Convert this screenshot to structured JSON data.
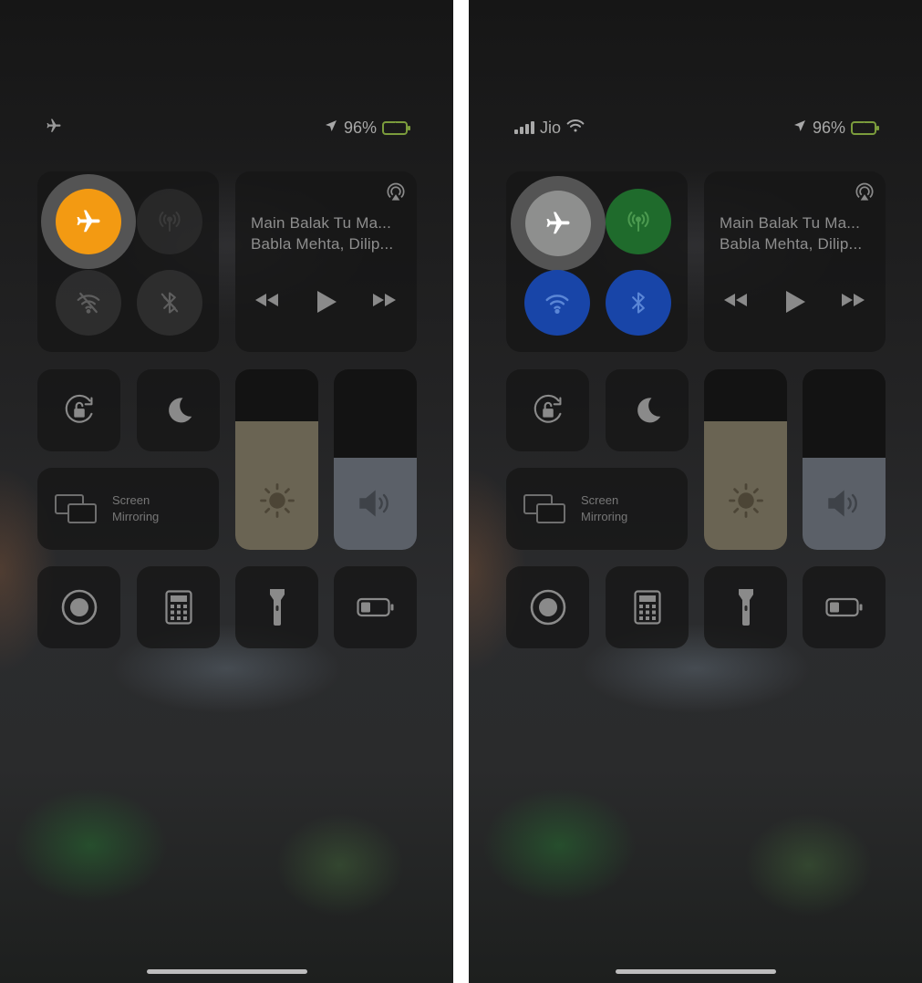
{
  "screens": [
    {
      "status": {
        "carrier": "",
        "battery": "96%",
        "airplane": true
      },
      "media": {
        "title": "Main Balak Tu Ma...",
        "artist": "Babla Mehta, Dilip..."
      },
      "screen_mirroring": "Screen\nMirroring",
      "toggles": {
        "airplane": "on",
        "cellular": "off",
        "wifi": "off",
        "bluetooth": "off"
      },
      "brightness_level": 0.71,
      "volume_level": 0.51,
      "colors": {
        "airplane_on": "#f39a12",
        "cellular_on": "#1f6b2c",
        "wifi_on": "#1845a8",
        "bluetooth_on": "#1845a8"
      }
    },
    {
      "status": {
        "carrier": "Jio",
        "battery": "96%",
        "airplane": false
      },
      "media": {
        "title": "Main Balak Tu Ma...",
        "artist": "Babla Mehta, Dilip..."
      },
      "screen_mirroring": "Screen\nMirroring",
      "toggles": {
        "airplane": "pressed",
        "cellular": "on",
        "wifi": "on",
        "bluetooth": "on"
      },
      "brightness_level": 0.71,
      "volume_level": 0.51
    }
  ]
}
